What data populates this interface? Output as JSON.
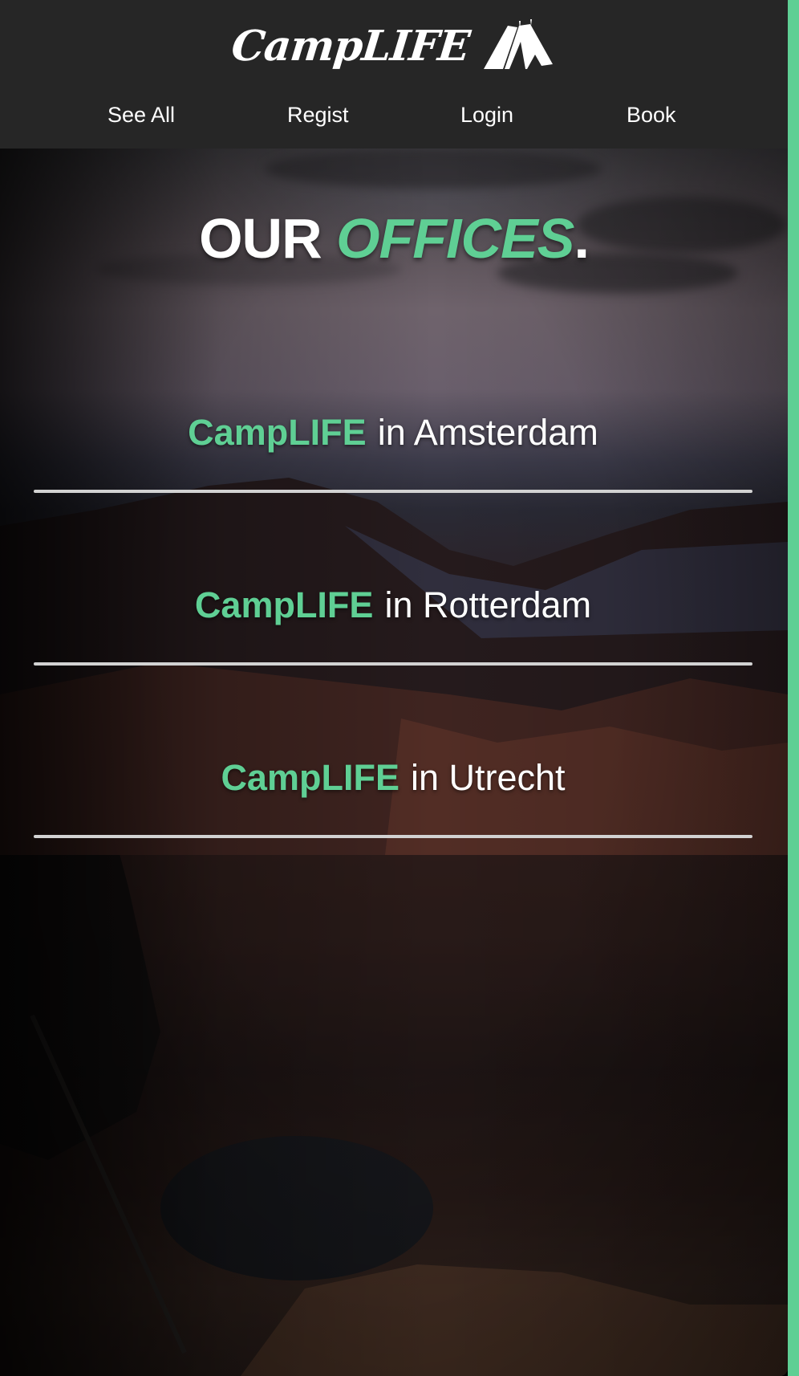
{
  "header": {
    "logo_text": "CampLIFE",
    "logo_icon": "tent-icon",
    "nav": [
      {
        "label": "See All"
      },
      {
        "label": "Regist"
      },
      {
        "label": "Login"
      },
      {
        "label": "Book"
      }
    ]
  },
  "hero": {
    "title_plain": "OUR",
    "title_accent": "OFFICES",
    "title_period": ".",
    "offices": [
      {
        "brand": "CampLIFE",
        "location": "in Amsterdam"
      },
      {
        "brand": "CampLIFE",
        "location": "in Rotterdam"
      },
      {
        "brand": "CampLIFE",
        "location": "in Utrecht"
      }
    ]
  },
  "colors": {
    "accent": "#5fcf94",
    "header_bg": "#262626",
    "text": "#ffffff",
    "divider": "#d2d2d2"
  }
}
